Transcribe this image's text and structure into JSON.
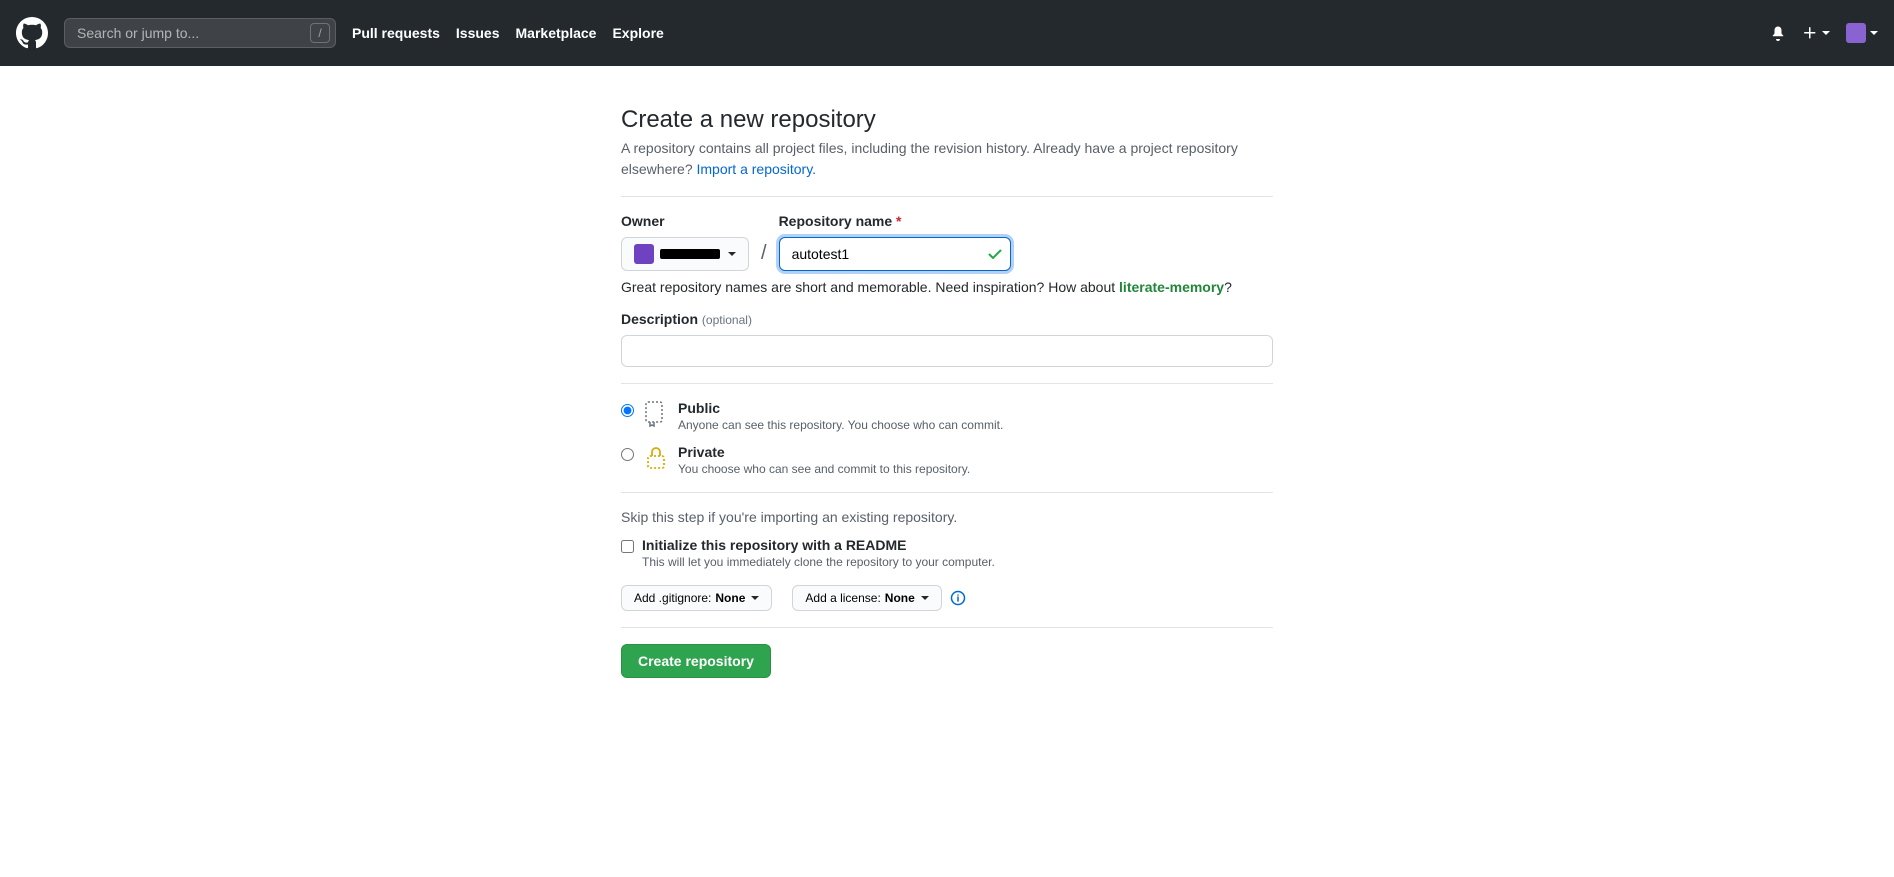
{
  "header": {
    "search_placeholder": "Search or jump to...",
    "nav": {
      "pulls": "Pull requests",
      "issues": "Issues",
      "marketplace": "Marketplace",
      "explore": "Explore"
    }
  },
  "page": {
    "title": "Create a new repository",
    "subtitle": "A repository contains all project files, including the revision history. Already have a project repository elsewhere? ",
    "import_link": "Import a repository."
  },
  "form": {
    "owner_label": "Owner",
    "repo_label": "Repository name",
    "repo_value": "autotest1",
    "hint_prefix": "Great repository names are short and memorable. Need inspiration? How about ",
    "hint_suggestion": "literate-memory",
    "hint_suffix": "?",
    "desc_label": "Description",
    "desc_optional": "(optional)",
    "public": {
      "title": "Public",
      "sub": "Anyone can see this repository. You choose who can commit."
    },
    "private": {
      "title": "Private",
      "sub": "You choose who can see and commit to this repository."
    },
    "skip_note": "Skip this step if you're importing an existing repository.",
    "readme": {
      "title": "Initialize this repository with a README",
      "sub": "This will let you immediately clone the repository to your computer."
    },
    "gitignore_prefix": "Add .gitignore: ",
    "gitignore_value": "None",
    "license_prefix": "Add a license: ",
    "license_value": "None",
    "submit": "Create repository"
  }
}
